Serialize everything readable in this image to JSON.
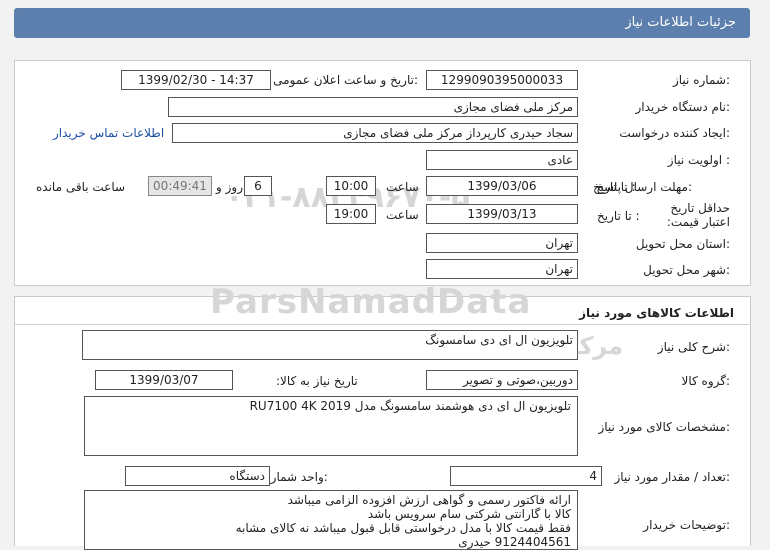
{
  "header": {
    "title": "جزئیات اطلاعات نیاز"
  },
  "info": {
    "need_number_label": "شماره نیاز:",
    "need_number": "1299090395000033",
    "announce_label": "تاریخ و ساعت اعلان عمومی:",
    "announce_value": "1399/02/30 - 14:37",
    "buyer_org_label": "نام دستگاه خریدار:",
    "buyer_org": "مرکز ملی فضای مجازی",
    "creator_label": "ایجاد کننده درخواست:",
    "creator": "سجاد حیدری کارپرداز مرکز ملی فضای مجازی",
    "contact_link": "اطلاعات تماس خریدار",
    "priority_label": "اولویت نیاز :",
    "priority": "عادی",
    "reply_deadline_label": "مهلت ارسال پاسخ:",
    "to_date_label": "تا تاریخ :",
    "reply_date": "1399/03/06",
    "time_label": "ساعت",
    "reply_time": "10:00",
    "days": "6",
    "days_label": "روز و",
    "remaining_time": "00:49:41",
    "remaining_label": "ساعت باقی مانده",
    "validity_label": "حداقل تاریخ اعتبار قیمت:",
    "validity_to_label": "تا تاریخ :",
    "validity_date": "1399/03/13",
    "validity_time_label": "ساعت",
    "validity_time": "19:00",
    "province_label": "استان محل تحویل:",
    "province": "تهران",
    "city_label": "شهر محل تحویل:",
    "city": "تهران"
  },
  "goods": {
    "section_title": "اطلاعات کالاهای مورد نیاز",
    "summary_label": "شرح کلی نیاز:",
    "summary": "تلویزیون ال ای دی سامسونگ",
    "group_label": "گروه کالا:",
    "group": "دوربین،صوتی و تصویر",
    "need_date_label": "تاریخ نیاز به کالا:",
    "need_date": "1399/03/07",
    "specs_label": "مشخصات کالای مورد نیاز:",
    "specs": "تلویزیون ال ای دی هوشمند سامسونگ مدل RU7100 4K 2019",
    "qty_label": "تعداد / مقدار مورد نیاز:",
    "qty": "4",
    "unit_label": "واحد شمارش:",
    "unit": "دستگاه",
    "notes_label": "توضیحات خریدار:",
    "notes": [
      "ارائه فاکتور رسمی و گواهی ارزش افزوده الزامی میباشد",
      "کالا با گارانتی شرکتی سام سرویس باشد",
      "فقط قیمت کالا با مدل درخواستی قابل قبول میباشد نه کالای مشابه",
      "9124404561 حیدری"
    ]
  },
  "watermark": {
    "brand": "ParsNamadData",
    "brand_fa": "مرکز اطلاعات پارس نماد داده ها",
    "phone": "۰۲۱-۸۸۳۴۹۶۷۰-۵"
  }
}
